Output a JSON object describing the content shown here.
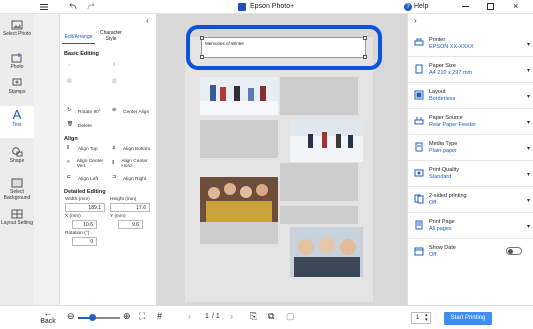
{
  "window": {
    "title": "Epson Photo+",
    "help_label": "Help"
  },
  "rail": {
    "items": [
      {
        "label": "Select Photo",
        "icon": "image-icon"
      },
      {
        "label": "Photo",
        "icon": "add-photo-icon"
      },
      {
        "label": "Stamps",
        "icon": "stamp-icon"
      },
      {
        "label": "Text",
        "icon": "text-icon"
      },
      {
        "label": "Shape",
        "icon": "shape-icon"
      },
      {
        "label": "Select Background",
        "icon": "background-icon"
      },
      {
        "label": "Layout Setting",
        "icon": "layout-icon"
      }
    ]
  },
  "edit_panel": {
    "tabs": [
      {
        "label": "Edit/Arrange"
      },
      {
        "label": "Character Style"
      }
    ],
    "basic_editing": {
      "title": "Basic Editing",
      "commands": [
        {
          "label": "Rotate 90°"
        },
        {
          "label": "Center Align"
        },
        {
          "label": "Delete"
        }
      ]
    },
    "align": {
      "title": "Align",
      "commands": [
        {
          "label": "Align Top"
        },
        {
          "label": "Align Bottom"
        },
        {
          "label": "Align Center Vert."
        },
        {
          "label": "Align Center Horiz."
        },
        {
          "label": "Align Left"
        },
        {
          "label": "Align Right"
        }
      ]
    },
    "detailed": {
      "title": "Detailed Editing",
      "width_label": "Width (mm)",
      "width_value": "189.1",
      "height_label": "Height (mm)",
      "height_value": "17.6",
      "x_label": "X (mm)",
      "x_value": "10.6",
      "y_label": "Y (mm)",
      "y_value": "9.6",
      "rotation_label": "Rotation (°)",
      "rotation_value": "0"
    }
  },
  "canvas": {
    "text_box_value": "Memories of Winter"
  },
  "settings": {
    "rows": [
      {
        "label": "Printer",
        "value": "EPSON XX-XXXX",
        "icon": "printer-icon"
      },
      {
        "label": "Paper Size",
        "value": "A4 210 x 297 mm",
        "icon": "paper-size-icon"
      },
      {
        "label": "Layout",
        "value": "Borderless",
        "icon": "layout-icon"
      },
      {
        "label": "Paper Source",
        "value": "Rear Paper Feeder",
        "icon": "paper-source-icon"
      },
      {
        "label": "Media Type",
        "value": "Plain paper",
        "icon": "media-icon"
      },
      {
        "label": "Print Quality",
        "value": "Standard",
        "icon": "quality-icon"
      },
      {
        "label": "2-sided printing",
        "value": "Off",
        "icon": "duplex-icon"
      },
      {
        "label": "Print Page",
        "value": "All pages",
        "icon": "pages-icon"
      },
      {
        "label": "Show Date",
        "value": "Off",
        "icon": "calendar-icon"
      }
    ]
  },
  "bottom": {
    "back_label": "Back",
    "page_current": "1",
    "page_total": "/ 1",
    "copies_value": "1",
    "start_label": "Start Printing"
  },
  "colors": {
    "accent": "#1f5fc2",
    "highlight": "#0a52e0",
    "start_button": "#3d8ef0"
  }
}
